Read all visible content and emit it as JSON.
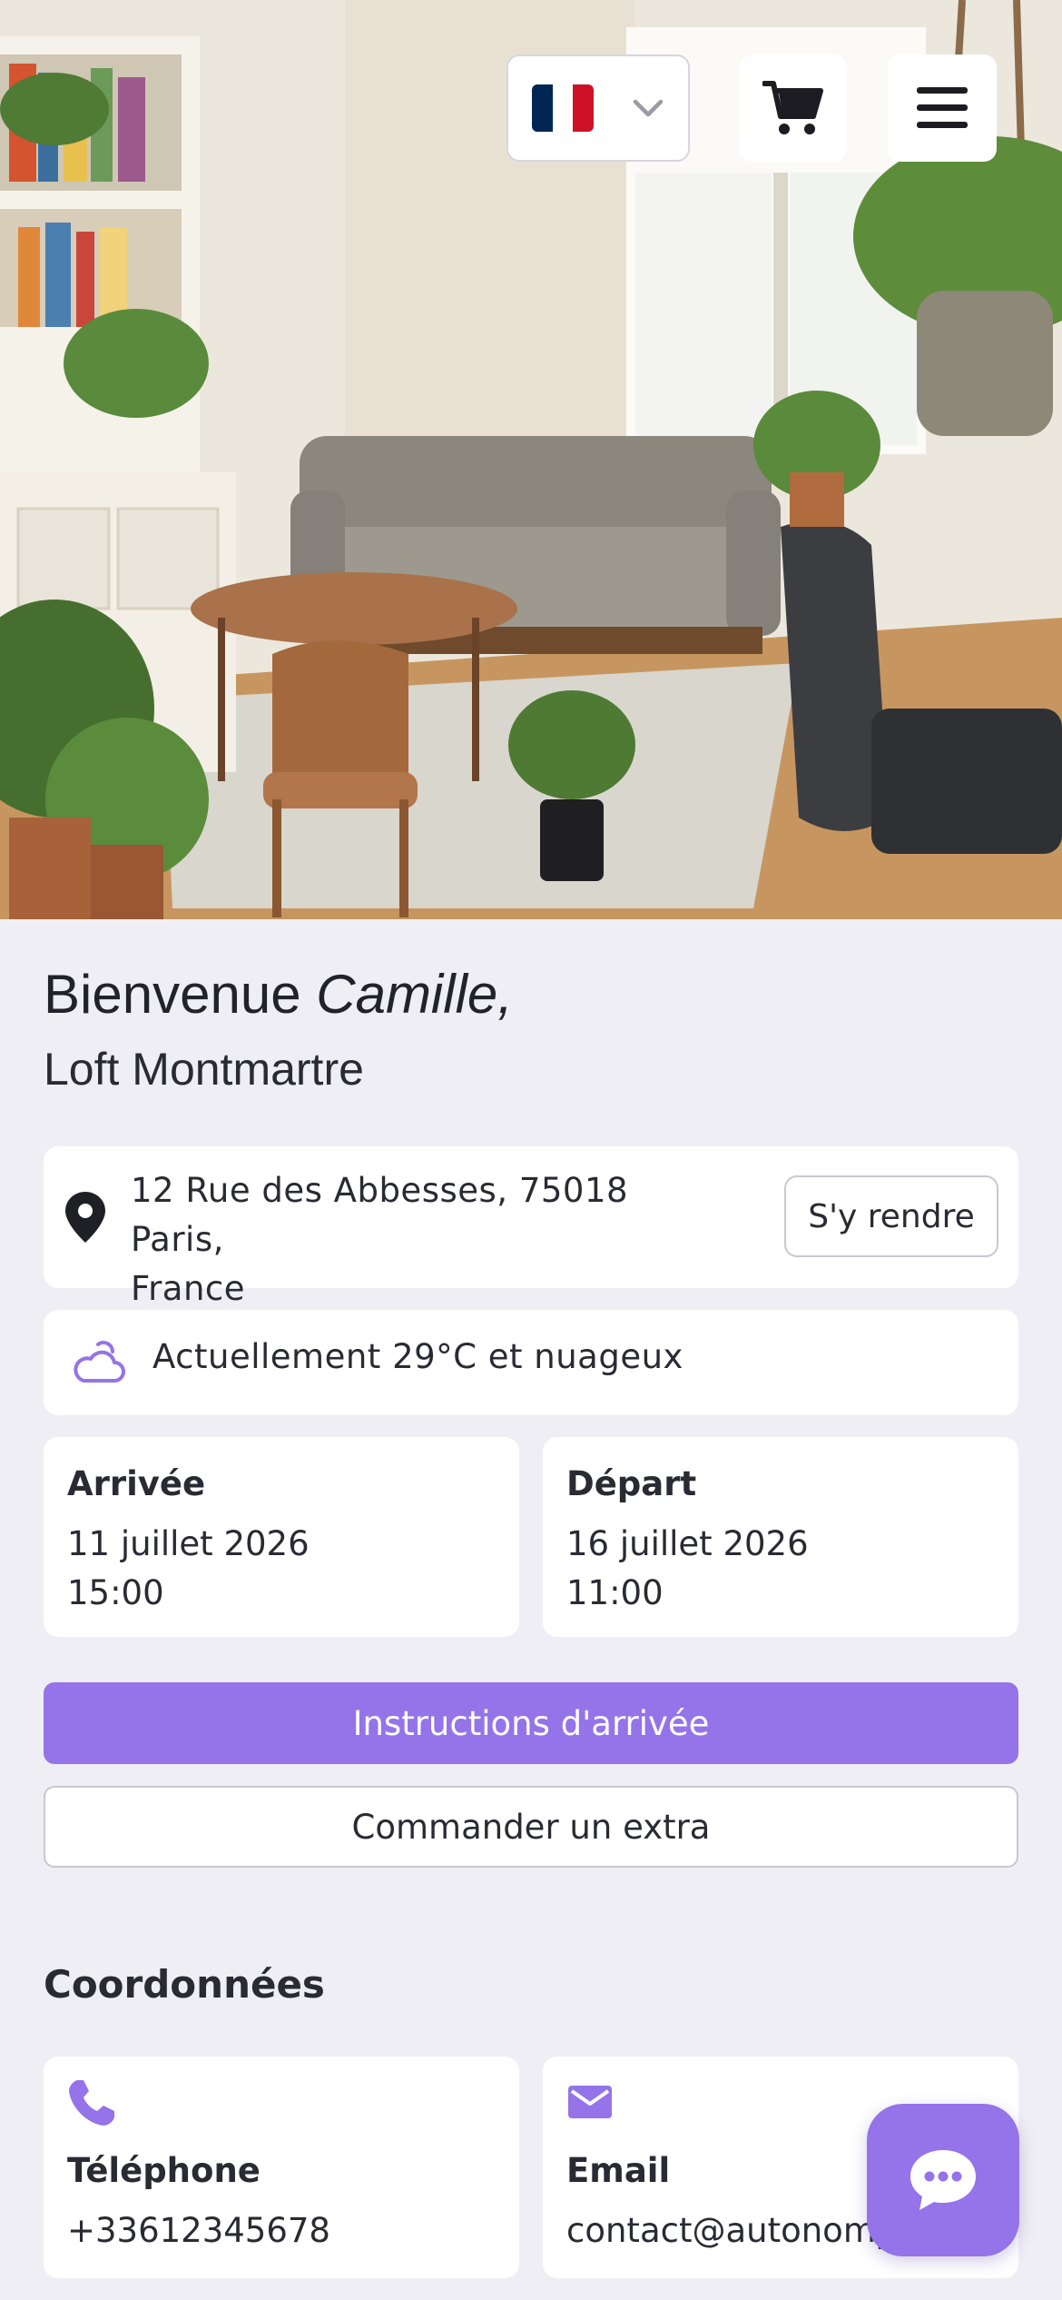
{
  "header": {
    "language": {
      "selected": "FR",
      "flag_colors": [
        "#002654",
        "#ffffff",
        "#ce1126"
      ]
    },
    "cart_icon": "cart-icon",
    "menu_icon": "hamburger-menu-icon"
  },
  "welcome": {
    "greeting": "Bienvenue",
    "guest_name": "Camille,",
    "property_name": "Loft Montmartre"
  },
  "address": {
    "line1": "12 Rue des Abbesses, 75018 Paris,",
    "line2": "France",
    "directions_label": "S'y rendre"
  },
  "weather": {
    "text": "Actuellement 29°C et nuageux",
    "icon": "cloud-sun-icon"
  },
  "checkin": {
    "label": "Arrivée",
    "date": "11 juillet 2026",
    "time": "15:00"
  },
  "checkout": {
    "label": "Départ",
    "date": "16 juillet 2026",
    "time": "11:00"
  },
  "actions": {
    "primary": "Instructions d'arrivée",
    "secondary": "Commander un extra"
  },
  "contact": {
    "title": "Coordonnées",
    "phone_label": "Téléphone",
    "phone_value": "+33612345678",
    "email_label": "Email",
    "email_value": "contact@autonomy"
  },
  "colors": {
    "accent": "#9474e8",
    "background": "#efeef4",
    "text": "#2a2a33"
  }
}
